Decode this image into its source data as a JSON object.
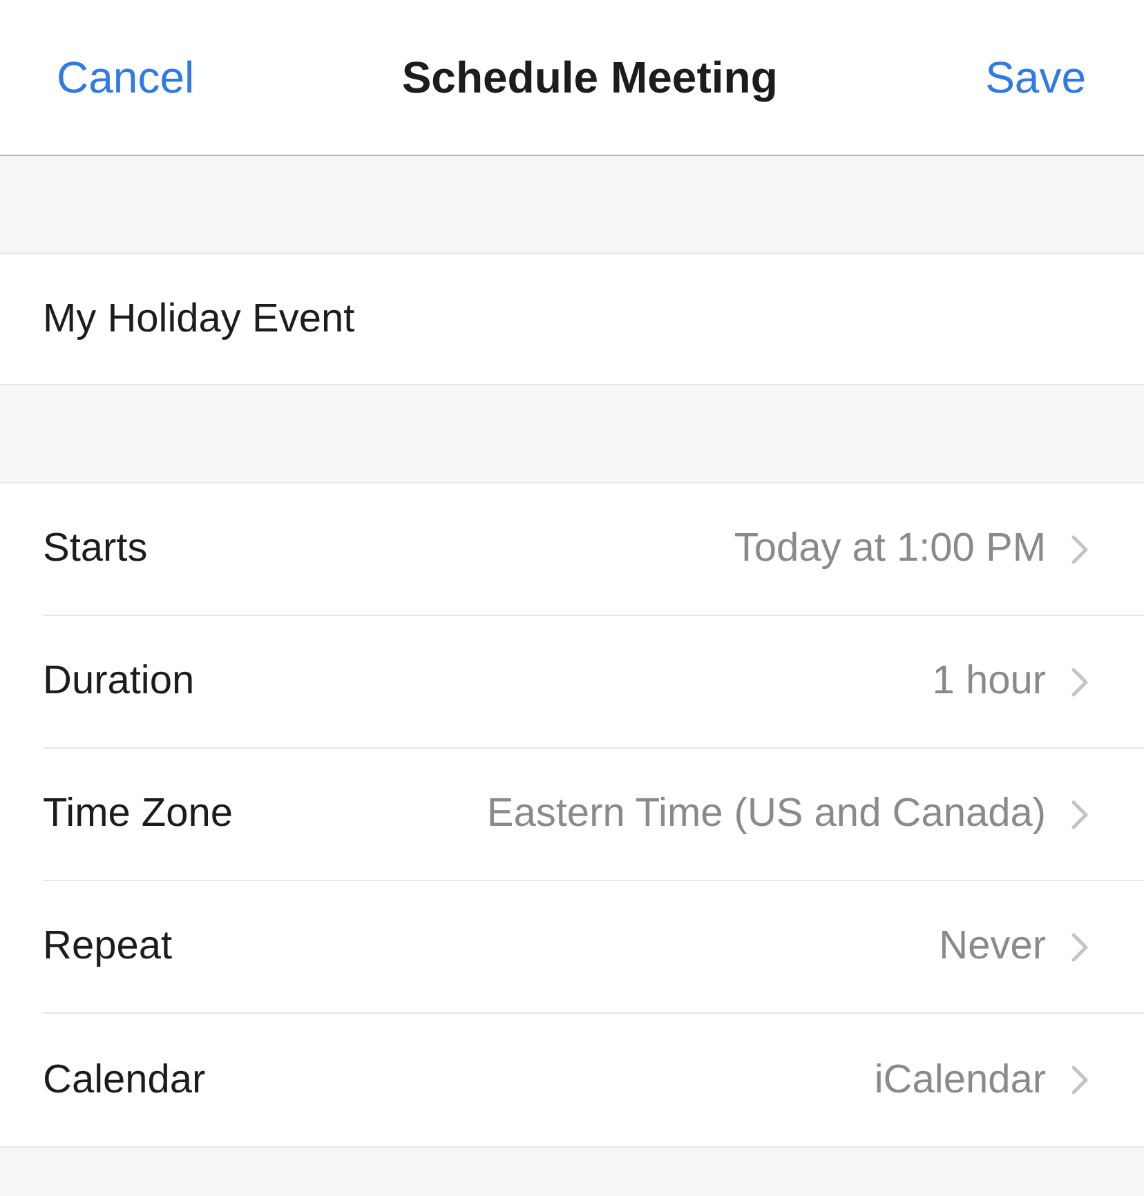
{
  "nav_bar": {
    "cancel": "Cancel",
    "title": "Schedule Meeting",
    "save": "Save"
  },
  "topic": {
    "value": "My Holiday Event"
  },
  "settings": [
    {
      "label": "Starts",
      "value": "Today at 1:00 PM"
    },
    {
      "label": "Duration",
      "value": "1 hour"
    },
    {
      "label": "Time Zone",
      "value": "Eastern Time (US and Canada)"
    },
    {
      "label": "Repeat",
      "value": "Never"
    },
    {
      "label": "Calendar",
      "value": "iCalendar"
    }
  ]
}
